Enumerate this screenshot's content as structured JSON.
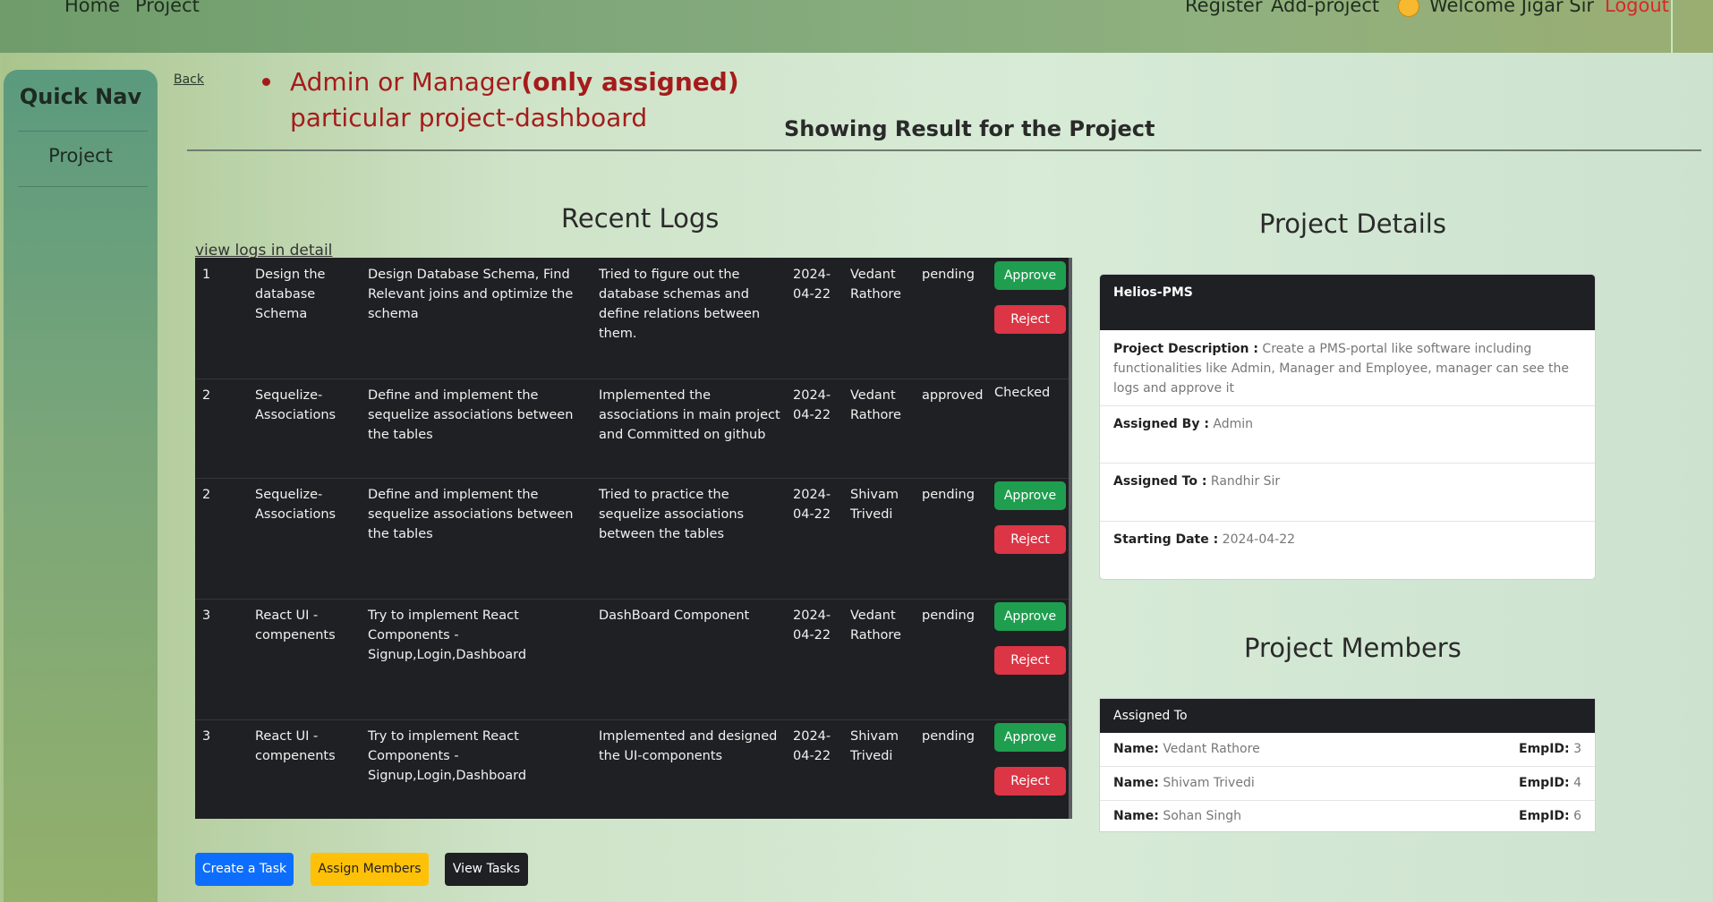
{
  "nav": {
    "home": "Home",
    "project": "Project",
    "register": "Register",
    "add_project": "Add-project",
    "welcome": "Welcome Jigar Sir",
    "logout": "Logout"
  },
  "sidebar": {
    "title": "Quick Nav",
    "items": [
      {
        "label": "Project"
      }
    ]
  },
  "back_link": "Back",
  "note": {
    "prefix": "Admin or Manager",
    "bold": "(only assigned)",
    "line2": "particular project-dashboard"
  },
  "result_heading": "Showing Result for the Project",
  "logs": {
    "heading": "Recent Logs",
    "view_link": "view logs in detail",
    "rows": [
      {
        "id": "1",
        "task": "Design the database Schema",
        "description": "Design Database Schema, Find Relevant joins and optimize the schema",
        "note": "Tried to figure out the database schemas and define relations between them.",
        "date": "2024-04-22",
        "employee": "Vedant Rathore",
        "status": "pending",
        "approve": "Approve",
        "reject": "Reject"
      },
      {
        "id": "2",
        "task": "Sequelize-Associations",
        "description": "Define and implement the sequelize associations between the tables",
        "note": "Implemented the associations in main project and Committed on github",
        "date": "2024-04-22",
        "employee": "Vedant Rathore",
        "status": "approved",
        "checked": "Checked"
      },
      {
        "id": "2",
        "task": "Sequelize-Associations",
        "description": "Define and implement the sequelize associations between the tables",
        "note": "Tried to practice the sequelize associations between the tables",
        "date": "2024-04-22",
        "employee": "Shivam Trivedi",
        "status": "pending",
        "approve": "Approve",
        "reject": "Reject"
      },
      {
        "id": "3",
        "task": "React UI - compenents",
        "description": "Try to implement React Components - Signup,Login,Dashboard",
        "note": "DashBoard Component",
        "date": "2024-04-22",
        "employee": "Vedant Rathore",
        "status": "pending",
        "approve": "Approve",
        "reject": "Reject"
      },
      {
        "id": "3",
        "task": "React UI - compenents",
        "description": "Try to implement React Components - Signup,Login,Dashboard",
        "note": "Implemented and designed the UI-components",
        "date": "2024-04-22",
        "employee": "Shivam Trivedi",
        "status": "pending",
        "approve": "Approve",
        "reject": "Reject"
      }
    ]
  },
  "details": {
    "heading": "Project Details",
    "name": "Helios-PMS",
    "description_label": "Project Description :",
    "description": "Create a PMS-portal like software including functionalities like Admin, Manager and Employee, manager can see the logs and approve it",
    "assigned_by_label": "Assigned By :",
    "assigned_by": "Admin",
    "assigned_to_label": "Assigned To :",
    "assigned_to": "Randhir Sir",
    "start_label": "Starting Date :",
    "start": "2024-04-22"
  },
  "members": {
    "heading": "Project Members",
    "header": "Assigned To",
    "name_label": "Name:",
    "emp_label": "EmpID:",
    "rows": [
      {
        "name": "Vedant Rathore",
        "emp_id": "3"
      },
      {
        "name": "Shivam Trivedi",
        "emp_id": "4"
      },
      {
        "name": "Sohan Singh",
        "emp_id": "6"
      }
    ]
  },
  "actions": {
    "create_task": "Create a Task",
    "assign_members": "Assign Members",
    "view_tasks": "View Tasks"
  }
}
